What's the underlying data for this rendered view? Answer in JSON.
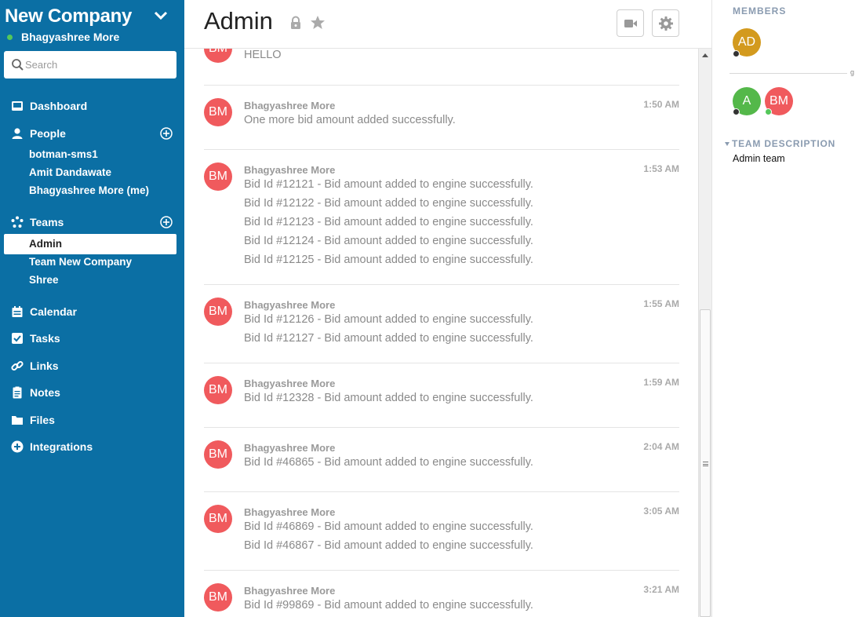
{
  "sidebar": {
    "company": "New Company",
    "user": "Bhagyashree More",
    "search_placeholder": "Search",
    "nav": {
      "dashboard": "Dashboard",
      "people": "People",
      "teams": "Teams",
      "calendar": "Calendar",
      "tasks": "Tasks",
      "links": "Links",
      "notes": "Notes",
      "files": "Files",
      "integrations": "Integrations"
    },
    "people": [
      "botman-sms1",
      "Amit Dandawate",
      "Bhagyashree More (me)"
    ],
    "teams": [
      "Admin",
      "Team New Company",
      "Shree"
    ]
  },
  "header": {
    "title": "Admin"
  },
  "messages": [
    {
      "initials": "BM",
      "sender": "",
      "time": "",
      "lines": [
        "HELLO"
      ]
    },
    {
      "initials": "BM",
      "sender": "Bhagyashree More",
      "time": "1:50 AM",
      "lines": [
        "One more bid amount added successfully."
      ]
    },
    {
      "initials": "BM",
      "sender": "Bhagyashree More",
      "time": "1:53 AM",
      "lines": [
        "Bid Id #12121 - Bid amount added to engine successfully.",
        "Bid Id #12122 - Bid amount added to engine successfully.",
        "Bid Id #12123 - Bid amount added to engine successfully.",
        "Bid Id #12124 - Bid amount added to engine successfully.",
        "Bid Id #12125 - Bid amount added to engine successfully."
      ]
    },
    {
      "initials": "BM",
      "sender": "Bhagyashree More",
      "time": "1:55 AM",
      "lines": [
        "Bid Id #12126 - Bid amount added to engine successfully.",
        "Bid Id #12127 - Bid amount added to engine successfully."
      ]
    },
    {
      "initials": "BM",
      "sender": "Bhagyashree More",
      "time": "1:59 AM",
      "lines": [
        "Bid Id #12328 - Bid amount added to engine successfully."
      ]
    },
    {
      "initials": "BM",
      "sender": "Bhagyashree More",
      "time": "2:04 AM",
      "lines": [
        "Bid Id #46865 - Bid amount added to engine successfully."
      ]
    },
    {
      "initials": "BM",
      "sender": "Bhagyashree More",
      "time": "3:05 AM",
      "lines": [
        "Bid Id #46869 - Bid amount added to engine successfully.",
        "Bid Id #46867 - Bid amount added to engine successfully."
      ]
    },
    {
      "initials": "BM",
      "sender": "Bhagyashree More",
      "time": "3:21 AM",
      "lines": [
        "Bid Id #99869 - Bid amount added to engine successfully."
      ]
    }
  ],
  "right_panel": {
    "members_label": "MEMBERS",
    "owner": {
      "initials": "AD",
      "color": "#d39a1e",
      "status": "offline"
    },
    "members": [
      {
        "initials": "A",
        "color": "#54b84a",
        "status": "offline"
      },
      {
        "initials": "BM",
        "color": "#f05a5d",
        "status": "online"
      }
    ],
    "truncated_char": "g",
    "team_description_label": "TEAM DESCRIPTION",
    "team_description": "Admin team"
  },
  "colors": {
    "sidebar": "#0b6fa4",
    "avatar_bm": "#f05a5d",
    "online": "#54c75a"
  }
}
